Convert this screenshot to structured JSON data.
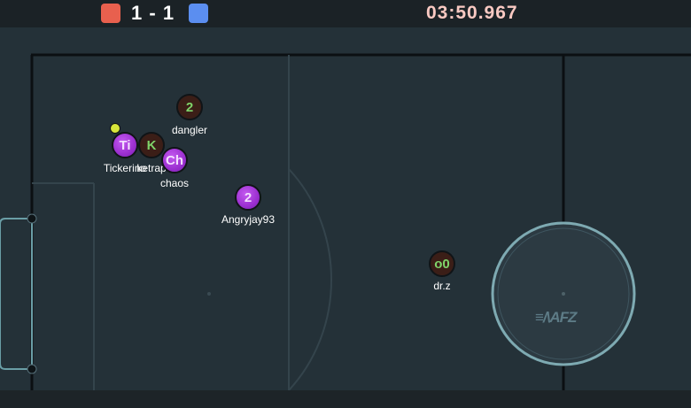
{
  "scoreboard": {
    "red_color": "#e8604e",
    "blue_color": "#5b8ef0",
    "red_score": "1",
    "separator": "-",
    "blue_score": "1",
    "timer": "03:50.967"
  },
  "field": {
    "background": "#243138",
    "line_color": "#0b0f12",
    "logo_text": "≡/\\AFZ"
  },
  "ball": {
    "color": "#d8e63a"
  },
  "players": [
    {
      "avatar": "2",
      "name": "dangler",
      "team": "red"
    },
    {
      "avatar": "Ti",
      "name": "Tickerino",
      "team": "purple"
    },
    {
      "avatar": "K",
      "name": "ketrap",
      "team": "red"
    },
    {
      "avatar": "Ch",
      "name": "chaos",
      "team": "purple"
    },
    {
      "avatar": "2",
      "name": "Angryjay93",
      "team": "purple"
    },
    {
      "avatar": "o0",
      "name": "dr.z",
      "team": "red"
    }
  ]
}
